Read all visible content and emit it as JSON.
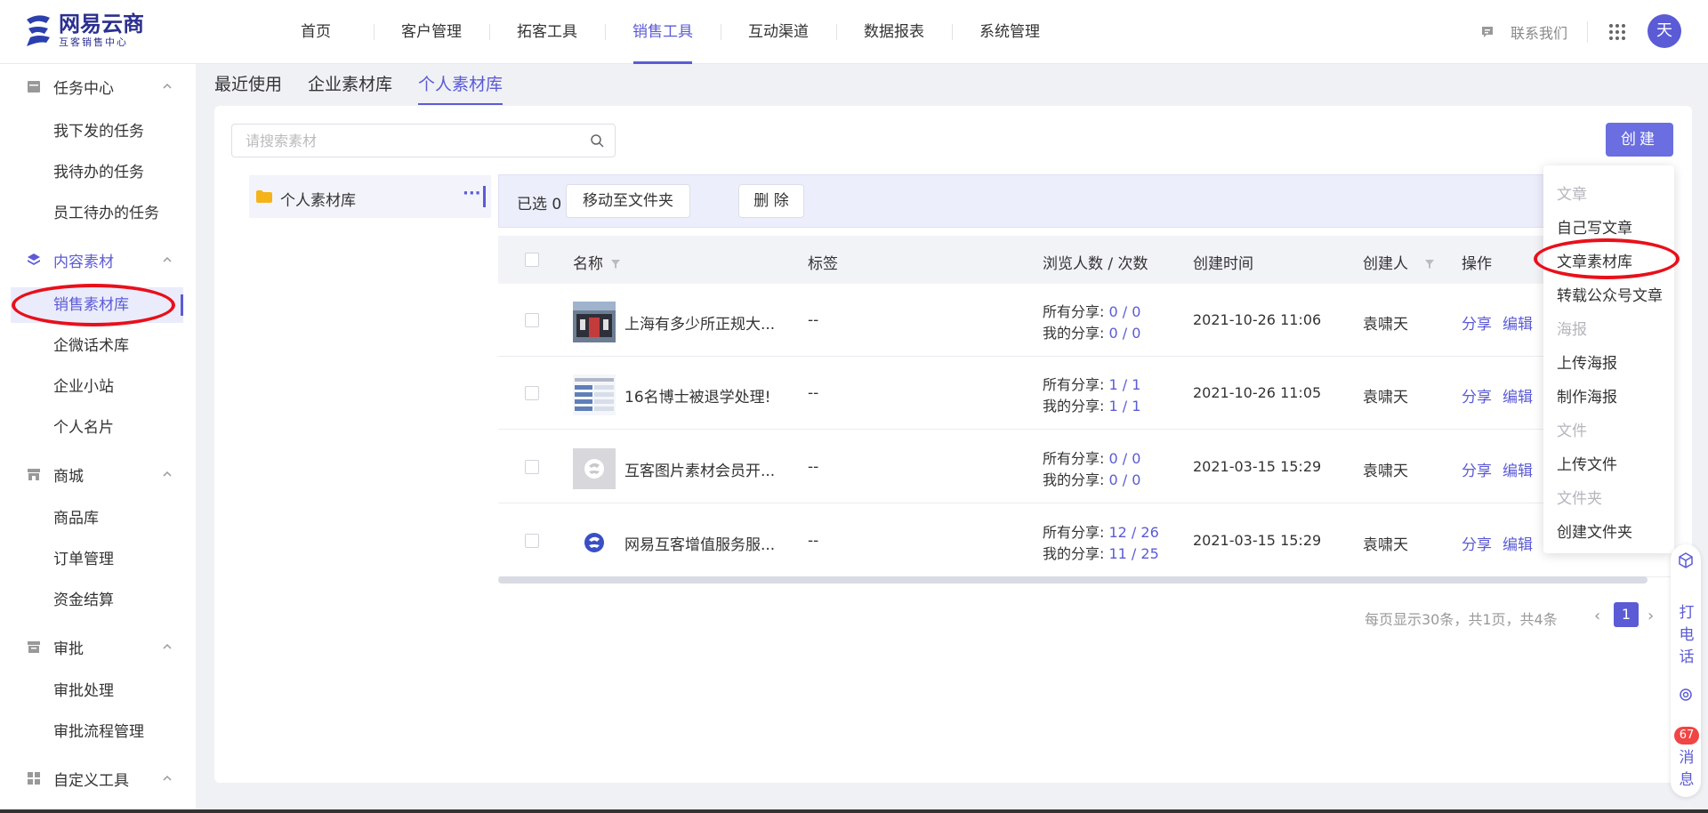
{
  "header": {
    "logo_main": "网易云商",
    "logo_sub": "互客销售中心",
    "nav": [
      "首页",
      "客户管理",
      "拓客工具",
      "销售工具",
      "互动渠道",
      "数据报表",
      "系统管理"
    ],
    "contact_label": "联系我们",
    "avatar_text": "天"
  },
  "sidebar": {
    "groups": [
      {
        "label": "任务中心",
        "items": [
          "我下发的任务",
          "我待办的任务",
          "员工待办的任务"
        ]
      },
      {
        "label": "内容素材",
        "items": [
          "销售素材库",
          "企微话术库",
          "企业小站",
          "个人名片"
        ]
      },
      {
        "label": "商城",
        "items": [
          "商品库",
          "订单管理",
          "资金结算"
        ]
      },
      {
        "label": "审批",
        "items": [
          "审批处理",
          "审批流程管理"
        ]
      },
      {
        "label": "自定义工具",
        "items": []
      }
    ]
  },
  "tabs": [
    "最近使用",
    "企业素材库",
    "个人素材库"
  ],
  "search": {
    "placeholder": "请搜索素材"
  },
  "create_label": "创建",
  "folder": {
    "label": "个人素材库",
    "more": "···"
  },
  "toolbar": {
    "selected": "已选 0 项",
    "move": "移动至文件夹",
    "delete": "删 除"
  },
  "table": {
    "headers": {
      "name": "名称",
      "tags": "标签",
      "views": "浏览人数 / 次数",
      "created": "创建时间",
      "creator": "创建人",
      "ops": "操作"
    },
    "stat_labels": {
      "all": "所有分享: ",
      "mine": "我的分享: "
    },
    "op_labels": {
      "share": "分享",
      "edit": "编辑"
    },
    "rows": [
      {
        "name": "上海有多少所正规大...",
        "tags": "--",
        "all": "0 / 0",
        "mine": "0 / 0",
        "time": "2021-10-26 11:06",
        "creator": "袁啸天"
      },
      {
        "name": "16名博士被退学处理!",
        "tags": "--",
        "all": "1 / 1",
        "mine": "1 / 1",
        "time": "2021-10-26 11:05",
        "creator": "袁啸天"
      },
      {
        "name": "互客图片素材会员开...",
        "tags": "--",
        "all": "0 / 0",
        "mine": "0 / 0",
        "time": "2021-03-15 15:29",
        "creator": "袁啸天"
      },
      {
        "name": "网易互客增值服务服...",
        "tags": "--",
        "all": "12 / 26",
        "mine": "11 / 25",
        "time": "2021-03-15 15:29",
        "creator": "袁啸天"
      }
    ]
  },
  "pager": {
    "info": "每页显示30条，共1页，共4条",
    "current": "1",
    "prev": "‹",
    "next": "›"
  },
  "dropdown": {
    "sections": [
      {
        "title": "文章",
        "items": [
          "自己写文章",
          "文章素材库",
          "转载公众号文章"
        ]
      },
      {
        "title": "海报",
        "items": [
          "上传海报",
          "制作海报"
        ]
      },
      {
        "title": "文件",
        "items": [
          "上传文件"
        ]
      },
      {
        "title": "文件夹",
        "items": [
          "创建文件夹"
        ]
      }
    ]
  },
  "float": {
    "call": "打电话",
    "msg": "消息",
    "badge": "67"
  },
  "colors": {
    "accent": "#5b5bd6",
    "annotation": "#e8101a"
  }
}
